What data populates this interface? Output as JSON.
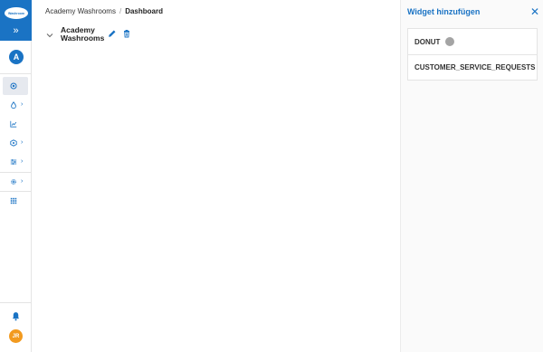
{
  "sidebar": {
    "logo_text": "Washroom",
    "expand_glyph": "»",
    "account_initial": "A",
    "nav": [
      {
        "icon": "dashboard-icon",
        "active": true
      },
      {
        "icon": "drop-icon",
        "has_submenu": true
      },
      {
        "icon": "chart-icon"
      },
      {
        "icon": "cube-settings-icon",
        "has_submenu": true
      },
      {
        "icon": "sliders-icon",
        "has_submenu": true
      },
      {
        "icon": "gear-icon",
        "has_submenu": true
      },
      {
        "icon": "grid-icon"
      }
    ],
    "caret_glyph": "›",
    "user_initials": "JR"
  },
  "breadcrumb": {
    "parent": "Academy Washrooms",
    "separator": "/",
    "current": "Dashboard"
  },
  "dashboard": {
    "title": "Academy Washrooms"
  },
  "panel": {
    "title": "Widget hinzufügen",
    "close_glyph": "✕",
    "widgets": [
      {
        "label": "DONUT",
        "status_color": "#a4a4a4"
      },
      {
        "label": "CUSTOMER_SERVICE_REQUESTS"
      }
    ]
  },
  "colors": {
    "brand": "#1a73c4",
    "avatar": "#f29a1f"
  }
}
